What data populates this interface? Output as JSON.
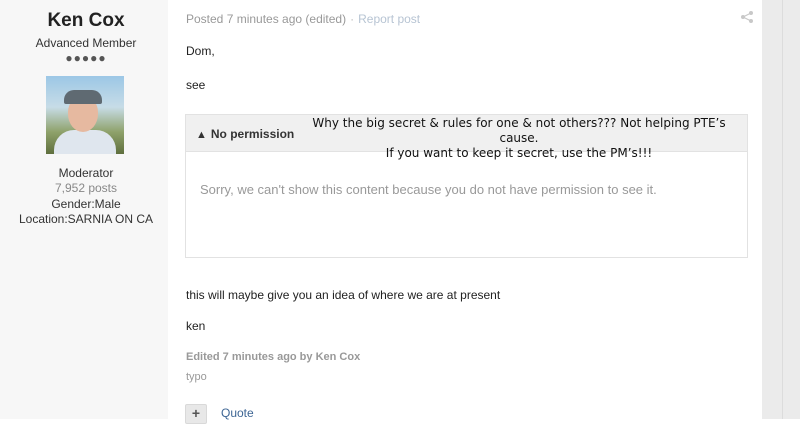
{
  "author": {
    "name": "Ken Cox",
    "title": "Advanced Member",
    "rank_pips": "●●●●●",
    "group": "Moderator",
    "posts": "7,952 posts",
    "gender": "Gender:Male",
    "location": "Location:SARNIA ON CA"
  },
  "post": {
    "posted": "Posted 7 minutes ago (edited)",
    "separator": "·",
    "report_label": "Report post",
    "greeting": "Dom,",
    "see": "see",
    "body_after": "this will maybe give you an idea of where we are at present",
    "signoff": "ken",
    "edited_by": "Edited 7 minutes ago by Ken Cox",
    "edit_reason": "typo",
    "quote_label": "Quote",
    "multiquote_label": "+"
  },
  "permission": {
    "warning_icon": "▲",
    "title": "No permission",
    "overlay_line1": "Why the big secret & rules for one & not others??? Not helping PTE’s cause.",
    "overlay_line2": "If you want to keep it secret, use the PM’s!!!",
    "message": "Sorry, we can't show this content because you do not have permission to see it."
  },
  "icons": {
    "share": "share-icon",
    "warning": "warning-icon",
    "avatar": "avatar-photo"
  },
  "colors": {
    "link": "#3d6594",
    "muted": "#999999",
    "sidebar_bg": "#f7f7f7"
  }
}
